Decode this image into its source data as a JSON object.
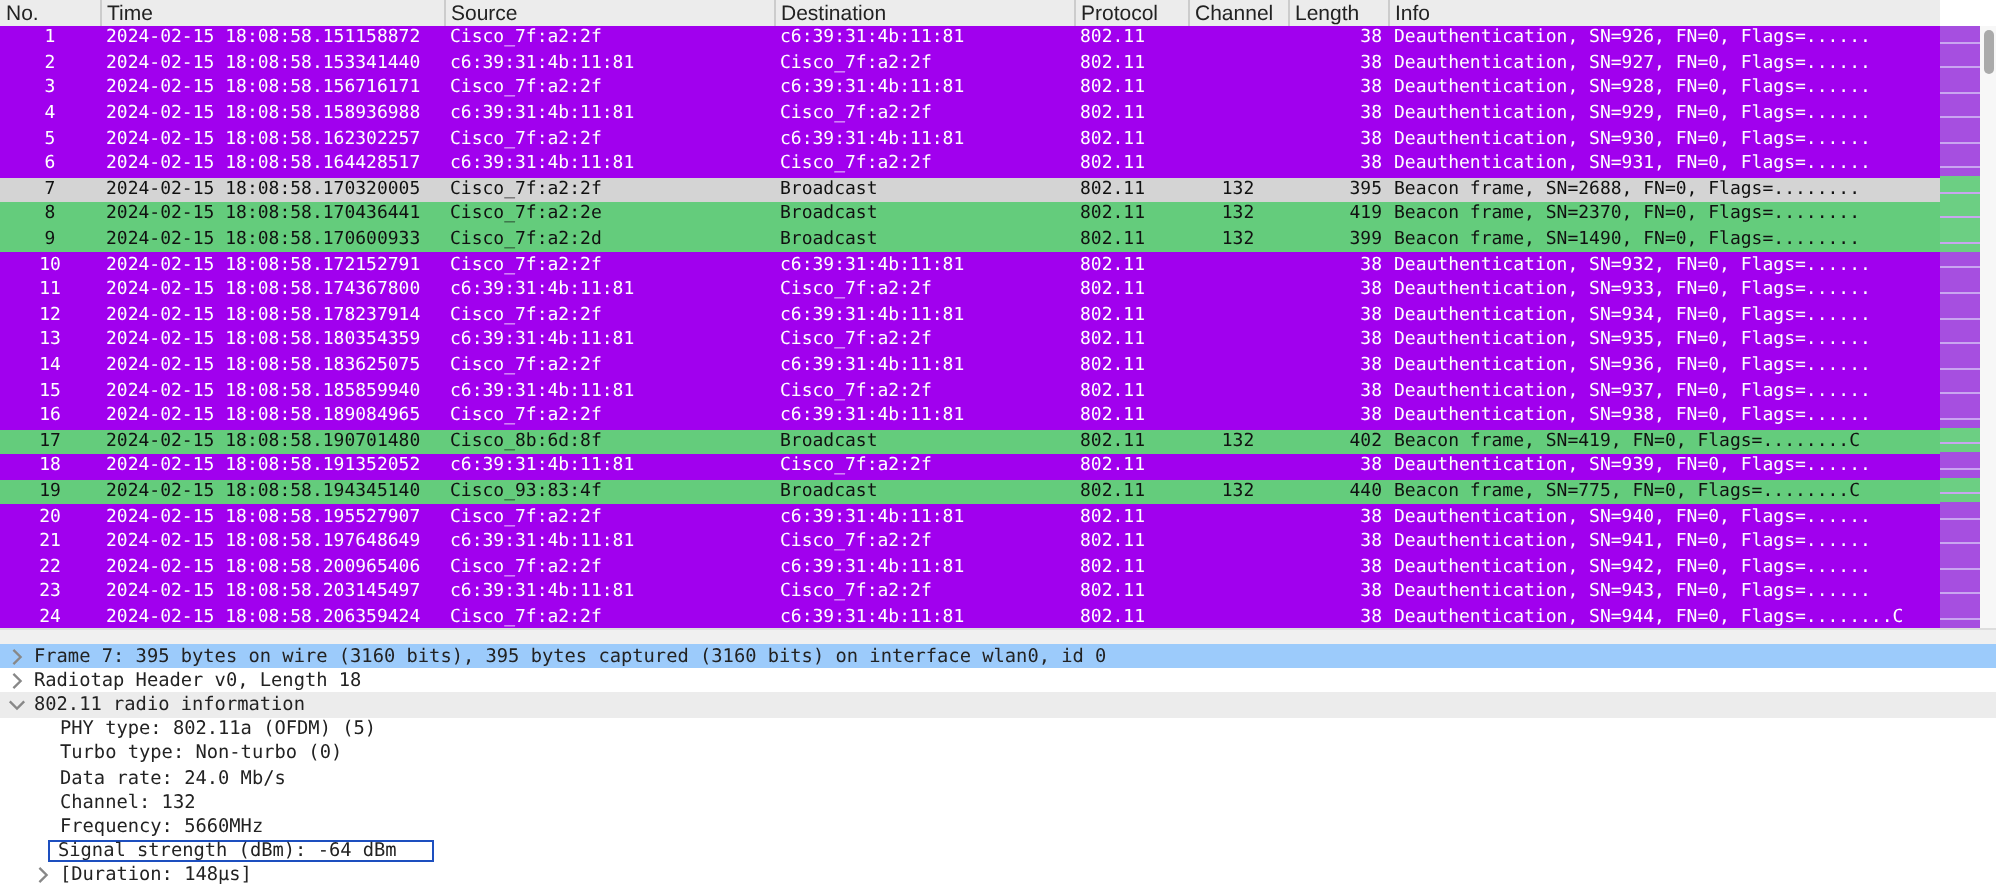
{
  "packet_list": {
    "columns": [
      "No.",
      "Time",
      "Source",
      "Destination",
      "Protocol",
      "Channel",
      "Length",
      "Info"
    ],
    "rows": [
      {
        "kind": "deauth",
        "selected": false,
        "cells": [
          "1",
          "2024-02-15 18:08:58.151158872",
          "Cisco_7f:a2:2f",
          "c6:39:31:4b:11:81",
          "802.11",
          "",
          "38",
          "Deauthentication, SN=926, FN=0, Flags=......"
        ]
      },
      {
        "kind": "deauth",
        "selected": false,
        "cells": [
          "2",
          "2024-02-15 18:08:58.153341440",
          "c6:39:31:4b:11:81",
          "Cisco_7f:a2:2f",
          "802.11",
          "",
          "38",
          "Deauthentication, SN=927, FN=0, Flags=......"
        ]
      },
      {
        "kind": "deauth",
        "selected": false,
        "cells": [
          "3",
          "2024-02-15 18:08:58.156716171",
          "Cisco_7f:a2:2f",
          "c6:39:31:4b:11:81",
          "802.11",
          "",
          "38",
          "Deauthentication, SN=928, FN=0, Flags=......"
        ]
      },
      {
        "kind": "deauth",
        "selected": false,
        "cells": [
          "4",
          "2024-02-15 18:08:58.158936988",
          "c6:39:31:4b:11:81",
          "Cisco_7f:a2:2f",
          "802.11",
          "",
          "38",
          "Deauthentication, SN=929, FN=0, Flags=......"
        ]
      },
      {
        "kind": "deauth",
        "selected": false,
        "cells": [
          "5",
          "2024-02-15 18:08:58.162302257",
          "Cisco_7f:a2:2f",
          "c6:39:31:4b:11:81",
          "802.11",
          "",
          "38",
          "Deauthentication, SN=930, FN=0, Flags=......"
        ]
      },
      {
        "kind": "deauth",
        "selected": false,
        "cells": [
          "6",
          "2024-02-15 18:08:58.164428517",
          "c6:39:31:4b:11:81",
          "Cisco_7f:a2:2f",
          "802.11",
          "",
          "38",
          "Deauthentication, SN=931, FN=0, Flags=......"
        ]
      },
      {
        "kind": "beacon",
        "selected": true,
        "cells": [
          "7",
          "2024-02-15 18:08:58.170320005",
          "Cisco_7f:a2:2f",
          "Broadcast",
          "802.11",
          "132",
          "395",
          "Beacon frame, SN=2688, FN=0, Flags=........"
        ]
      },
      {
        "kind": "beacon",
        "selected": false,
        "cells": [
          "8",
          "2024-02-15 18:08:58.170436441",
          "Cisco_7f:a2:2e",
          "Broadcast",
          "802.11",
          "132",
          "419",
          "Beacon frame, SN=2370, FN=0, Flags=........"
        ]
      },
      {
        "kind": "beacon",
        "selected": false,
        "cells": [
          "9",
          "2024-02-15 18:08:58.170600933",
          "Cisco_7f:a2:2d",
          "Broadcast",
          "802.11",
          "132",
          "399",
          "Beacon frame, SN=1490, FN=0, Flags=........"
        ]
      },
      {
        "kind": "deauth",
        "selected": false,
        "cells": [
          "10",
          "2024-02-15 18:08:58.172152791",
          "Cisco_7f:a2:2f",
          "c6:39:31:4b:11:81",
          "802.11",
          "",
          "38",
          "Deauthentication, SN=932, FN=0, Flags=......"
        ]
      },
      {
        "kind": "deauth",
        "selected": false,
        "cells": [
          "11",
          "2024-02-15 18:08:58.174367800",
          "c6:39:31:4b:11:81",
          "Cisco_7f:a2:2f",
          "802.11",
          "",
          "38",
          "Deauthentication, SN=933, FN=0, Flags=......"
        ]
      },
      {
        "kind": "deauth",
        "selected": false,
        "cells": [
          "12",
          "2024-02-15 18:08:58.178237914",
          "Cisco_7f:a2:2f",
          "c6:39:31:4b:11:81",
          "802.11",
          "",
          "38",
          "Deauthentication, SN=934, FN=0, Flags=......"
        ]
      },
      {
        "kind": "deauth",
        "selected": false,
        "cells": [
          "13",
          "2024-02-15 18:08:58.180354359",
          "c6:39:31:4b:11:81",
          "Cisco_7f:a2:2f",
          "802.11",
          "",
          "38",
          "Deauthentication, SN=935, FN=0, Flags=......"
        ]
      },
      {
        "kind": "deauth",
        "selected": false,
        "cells": [
          "14",
          "2024-02-15 18:08:58.183625075",
          "Cisco_7f:a2:2f",
          "c6:39:31:4b:11:81",
          "802.11",
          "",
          "38",
          "Deauthentication, SN=936, FN=0, Flags=......"
        ]
      },
      {
        "kind": "deauth",
        "selected": false,
        "cells": [
          "15",
          "2024-02-15 18:08:58.185859940",
          "c6:39:31:4b:11:81",
          "Cisco_7f:a2:2f",
          "802.11",
          "",
          "38",
          "Deauthentication, SN=937, FN=0, Flags=......"
        ]
      },
      {
        "kind": "deauth",
        "selected": false,
        "cells": [
          "16",
          "2024-02-15 18:08:58.189084965",
          "Cisco_7f:a2:2f",
          "c6:39:31:4b:11:81",
          "802.11",
          "",
          "38",
          "Deauthentication, SN=938, FN=0, Flags=......"
        ]
      },
      {
        "kind": "beacon",
        "selected": false,
        "cells": [
          "17",
          "2024-02-15 18:08:58.190701480",
          "Cisco_8b:6d:8f",
          "Broadcast",
          "802.11",
          "132",
          "402",
          "Beacon frame, SN=419, FN=0, Flags=........C"
        ]
      },
      {
        "kind": "deauth",
        "selected": false,
        "cells": [
          "18",
          "2024-02-15 18:08:58.191352052",
          "c6:39:31:4b:11:81",
          "Cisco_7f:a2:2f",
          "802.11",
          "",
          "38",
          "Deauthentication, SN=939, FN=0, Flags=......"
        ]
      },
      {
        "kind": "beacon",
        "selected": false,
        "cells": [
          "19",
          "2024-02-15 18:08:58.194345140",
          "Cisco_93:83:4f",
          "Broadcast",
          "802.11",
          "132",
          "440",
          "Beacon frame, SN=775, FN=0, Flags=........C"
        ]
      },
      {
        "kind": "deauth",
        "selected": false,
        "cells": [
          "20",
          "2024-02-15 18:08:58.195527907",
          "Cisco_7f:a2:2f",
          "c6:39:31:4b:11:81",
          "802.11",
          "",
          "38",
          "Deauthentication, SN=940, FN=0, Flags=......"
        ]
      },
      {
        "kind": "deauth",
        "selected": false,
        "cells": [
          "21",
          "2024-02-15 18:08:58.197648649",
          "c6:39:31:4b:11:81",
          "Cisco_7f:a2:2f",
          "802.11",
          "",
          "38",
          "Deauthentication, SN=941, FN=0, Flags=......"
        ]
      },
      {
        "kind": "deauth",
        "selected": false,
        "cells": [
          "22",
          "2024-02-15 18:08:58.200965406",
          "Cisco_7f:a2:2f",
          "c6:39:31:4b:11:81",
          "802.11",
          "",
          "38",
          "Deauthentication, SN=942, FN=0, Flags=......"
        ]
      },
      {
        "kind": "deauth",
        "selected": false,
        "cells": [
          "23",
          "2024-02-15 18:08:58.203145497",
          "c6:39:31:4b:11:81",
          "Cisco_7f:a2:2f",
          "802.11",
          "",
          "38",
          "Deauthentication, SN=943, FN=0, Flags=......"
        ]
      },
      {
        "kind": "deauth",
        "selected": false,
        "cells": [
          "24",
          "2024-02-15 18:08:58.206359424",
          "Cisco_7f:a2:2f",
          "c6:39:31:4b:11:81",
          "802.11",
          "",
          "38",
          "Deauthentication, SN=944, FN=0, Flags=........C"
        ]
      }
    ]
  },
  "packet_details": [
    {
      "text": "Frame 7: 395 bytes on wire (3160 bits), 395 bytes captured (3160 bits) on interface wlan0, id 0",
      "expanded": false,
      "selected": true
    },
    {
      "text": "Radiotap Header v0, Length 18",
      "expanded": false,
      "selected": false
    },
    {
      "text": "802.11 radio information",
      "expanded": true,
      "selected": false,
      "children": [
        {
          "text": "PHY type: 802.11a (OFDM) (5)",
          "outlined": false
        },
        {
          "text": "Turbo type: Non-turbo (0)",
          "outlined": false
        },
        {
          "text": "Data rate: 24.0 Mb/s",
          "outlined": false
        },
        {
          "text": "Channel: 132",
          "outlined": false
        },
        {
          "text": "Frequency: 5660MHz",
          "outlined": false
        },
        {
          "text": "Signal strength (dBm): -64 dBm",
          "outlined": true
        },
        {
          "text": "[Duration: 148µs]",
          "outlined": false,
          "expanded": false
        }
      ]
    }
  ]
}
